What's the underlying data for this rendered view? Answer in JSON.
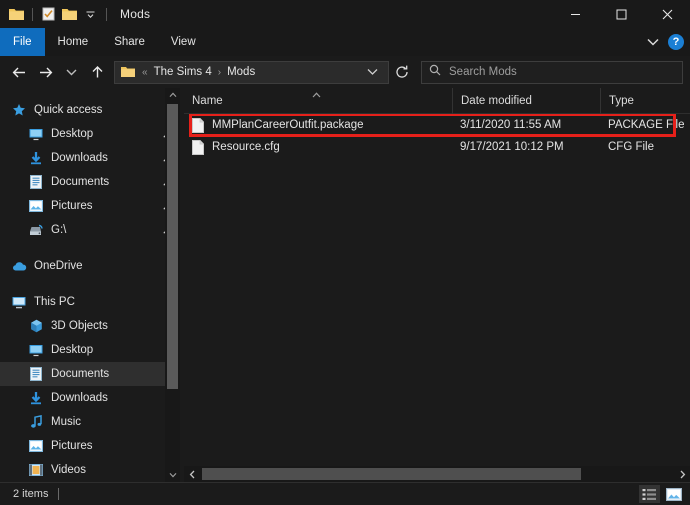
{
  "window": {
    "title": "Mods",
    "quick_access_icons": [
      "folder-icon",
      "properties-icon",
      "new-folder-icon",
      "chevron-down-icon"
    ],
    "minimize_label": "─",
    "maximize_label": "□",
    "close_label": "✕"
  },
  "ribbon": {
    "tabs": [
      {
        "label": "File",
        "active": true
      },
      {
        "label": "Home",
        "active": false
      },
      {
        "label": "Share",
        "active": false
      },
      {
        "label": "View",
        "active": false
      }
    ],
    "collapse_icon": "chevron-down-icon",
    "help_label": "?"
  },
  "addressbar": {
    "back_icon": "←",
    "forward_icon": "→",
    "recent_icon": "⌄",
    "up_icon": "↑",
    "overflow": "«",
    "crumbs": [
      "The Sims 4",
      "Mods"
    ],
    "separator": "›",
    "dropdown_icon": "⌄",
    "refresh_icon": "↻"
  },
  "search": {
    "placeholder": "Search Mods",
    "icon": "search-icon"
  },
  "sidebar": {
    "groups": [
      {
        "header": {
          "label": "Quick access",
          "icon": "star-icon"
        },
        "items": [
          {
            "label": "Desktop",
            "icon": "desktop-icon",
            "pinned": true
          },
          {
            "label": "Downloads",
            "icon": "download-icon",
            "pinned": true
          },
          {
            "label": "Documents",
            "icon": "documents-icon",
            "pinned": true
          },
          {
            "label": "Pictures",
            "icon": "pictures-icon",
            "pinned": true
          },
          {
            "label": "G:\\",
            "icon": "drive-icon",
            "pinned": true
          }
        ]
      },
      {
        "header": {
          "label": "OneDrive",
          "icon": "cloud-icon"
        },
        "items": []
      },
      {
        "header": {
          "label": "This PC",
          "icon": "pc-icon"
        },
        "items": [
          {
            "label": "3D Objects",
            "icon": "3d-objects-icon",
            "pinned": false
          },
          {
            "label": "Desktop",
            "icon": "desktop-icon",
            "pinned": false
          },
          {
            "label": "Documents",
            "icon": "documents-icon",
            "pinned": false,
            "selected": true
          },
          {
            "label": "Downloads",
            "icon": "download-icon",
            "pinned": false
          },
          {
            "label": "Music",
            "icon": "music-icon",
            "pinned": false
          },
          {
            "label": "Pictures",
            "icon": "pictures-icon",
            "pinned": false
          },
          {
            "label": "Videos",
            "icon": "videos-icon",
            "pinned": false
          }
        ]
      }
    ],
    "pin_glyph": "📌"
  },
  "filelist": {
    "columns": [
      {
        "label": "Name",
        "sorted": "asc"
      },
      {
        "label": "Date modified",
        "sorted": ""
      },
      {
        "label": "Type",
        "sorted": ""
      }
    ],
    "sort_caret": "⌃",
    "rows": [
      {
        "name": "MMPlanCareerOutfit.package",
        "date": "3/11/2020 11:55 AM",
        "type": "PACKAGE File",
        "icon": "file-icon",
        "annotated": true
      },
      {
        "name": "Resource.cfg",
        "date": "9/17/2021 10:12 PM",
        "type": "CFG File",
        "icon": "file-icon",
        "annotated": false
      }
    ]
  },
  "statusbar": {
    "item_count": "2 items",
    "view_details_icon": "details-view-icon",
    "view_large_icons_icon": "large-icons-view-icon"
  },
  "colors": {
    "accent": "#0f6cbd",
    "annotation": "#e6201a",
    "window_bg": "#1b1b1b",
    "folder_yellow": "#f4c969"
  }
}
